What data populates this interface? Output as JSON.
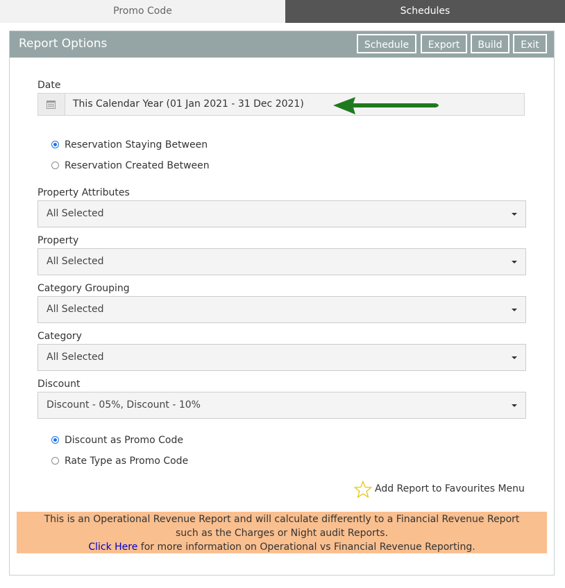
{
  "tabs": [
    {
      "label": "Promo Code",
      "active": false
    },
    {
      "label": "Schedules",
      "active": true
    }
  ],
  "panel": {
    "title": "Report Options",
    "buttons": {
      "schedule": "Schedule",
      "export": "Export",
      "build": "Build",
      "exit": "Exit"
    }
  },
  "date": {
    "label": "Date",
    "value": "This Calendar Year (01 Jan 2021 - 31 Dec 2021)",
    "icon": "calendar-icon"
  },
  "date_mode": {
    "options": [
      {
        "label": "Reservation Staying Between",
        "checked": true
      },
      {
        "label": "Reservation Created Between",
        "checked": false
      }
    ]
  },
  "filters": [
    {
      "label": "Property Attributes",
      "value": "All Selected"
    },
    {
      "label": "Property",
      "value": "All Selected"
    },
    {
      "label": "Category Grouping",
      "value": "All Selected"
    },
    {
      "label": "Category",
      "value": "All Selected"
    },
    {
      "label": "Discount",
      "value": "Discount - 05%, Discount - 10%"
    }
  ],
  "promo_mode": {
    "options": [
      {
        "label": "Discount as Promo Code",
        "checked": true
      },
      {
        "label": "Rate Type as Promo Code",
        "checked": false
      }
    ]
  },
  "favourites": {
    "label": "Add Report to Favourites Menu",
    "icon": "star-icon"
  },
  "notice": {
    "line1": "This is an Operational Revenue Report and will calculate differently to a Financial Revenue Report",
    "line2": "such as the Charges or Night audit Reports.",
    "link": "Click Here",
    "line3": " for more information on Operational vs Financial Revenue Reporting."
  },
  "colors": {
    "header_bg": "#95a5a6",
    "active_tab_bg": "#555555",
    "notice_bg": "#f9bf8f",
    "arrow": "#1f7a1f",
    "radio_accent": "#1a73e8"
  }
}
